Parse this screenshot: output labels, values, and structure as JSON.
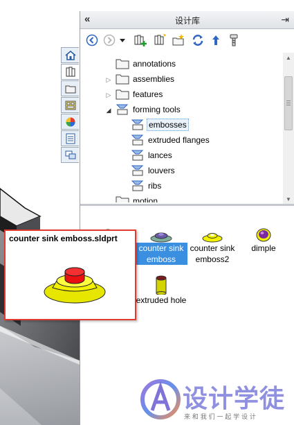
{
  "task_pane": {
    "title": "设计库",
    "collapse_glyph": "«",
    "pin_glyph": "⇥"
  },
  "toolbar": {
    "buttons": [
      "back-icon",
      "forward-icon",
      "dropdown-icon",
      "add-to-library-icon",
      "add-file-location-icon",
      "create-new-folder-icon",
      "refresh-icon",
      "up-one-level-icon",
      "toolbox-icon"
    ]
  },
  "tree": {
    "items": [
      {
        "label": "annotations"
      },
      {
        "label": "assemblies"
      },
      {
        "label": "features"
      },
      {
        "label": "forming tools"
      },
      {
        "label": "embosses"
      },
      {
        "label": "extruded flanges"
      },
      {
        "label": "lances"
      },
      {
        "label": "louvers"
      },
      {
        "label": "ribs"
      },
      {
        "label": "motion"
      }
    ]
  },
  "files": [
    {
      "name": "counter sink emboss"
    },
    {
      "name": "counter sink emboss2"
    },
    {
      "name": "dimple"
    },
    {
      "name": "extruded hole"
    }
  ],
  "preview": {
    "title": "counter sink emboss.sldprt"
  },
  "watermark": {
    "brand": "设计学徒",
    "slogan": "来 和 我 们 一 起 学 设 计"
  },
  "colors": {
    "selection": "#3a8fe0",
    "preview_border": "#e23a2e",
    "emboss_yellow": "#f2f200",
    "emboss_red": "#e81010"
  }
}
